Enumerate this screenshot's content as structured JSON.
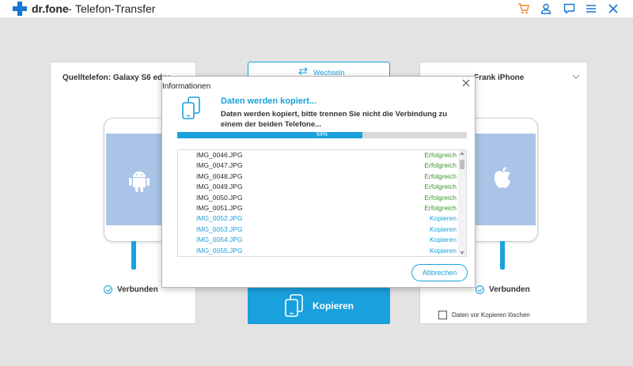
{
  "app": {
    "name": "dr.fone",
    "separator": "-",
    "title": "Telefon-Transfer"
  },
  "titlebar_icons": [
    "cart-icon",
    "user-icon",
    "chat-icon",
    "menu-icon",
    "close-icon"
  ],
  "source": {
    "label": "Quelltelefon: Galaxy S6 edge",
    "status": "Verbunden"
  },
  "switch": {
    "label": "Wechseln"
  },
  "target": {
    "label": "Frank iPhone",
    "status": "Verbunden"
  },
  "copy_button": {
    "label": "Kopieren"
  },
  "delete_option": {
    "label": "Daten vor Kopieren löschen",
    "checked": false
  },
  "dialog": {
    "title": "Informationen",
    "heading": "Daten werden kopiert...",
    "message": "Daten werden kopiert, bitte trennen Sie nicht die Verbindung zu einem der beiden Telefone...",
    "progress_percent": 64,
    "progress_label": "64%",
    "files": [
      {
        "name": "IMG_0046.JPG",
        "status": "Erfolgreich",
        "state": "done"
      },
      {
        "name": "IMG_0047.JPG",
        "status": "Erfolgreich",
        "state": "done"
      },
      {
        "name": "IMG_0048.JPG",
        "status": "Erfolgreich",
        "state": "done"
      },
      {
        "name": "IMG_0049.JPG",
        "status": "Erfolgreich",
        "state": "done"
      },
      {
        "name": "IMG_0050.JPG",
        "status": "Erfolgreich",
        "state": "done"
      },
      {
        "name": "IMG_0051.JPG",
        "status": "Erfolgreich",
        "state": "done"
      },
      {
        "name": "IMG_0052.JPG",
        "status": "Kopieren",
        "state": "pending"
      },
      {
        "name": "IMG_0053.JPG",
        "status": "Kopieren",
        "state": "pending"
      },
      {
        "name": "IMG_0054.JPG",
        "status": "Kopieren",
        "state": "pending"
      },
      {
        "name": "IMG_0055.JPG",
        "status": "Kopieren",
        "state": "pending"
      }
    ],
    "abort_label": "Abbrechen"
  },
  "colors": {
    "accent": "#1aa0dd",
    "brand": "#1877d2",
    "success": "#3a9a2a",
    "background": "#e3e3e3"
  }
}
